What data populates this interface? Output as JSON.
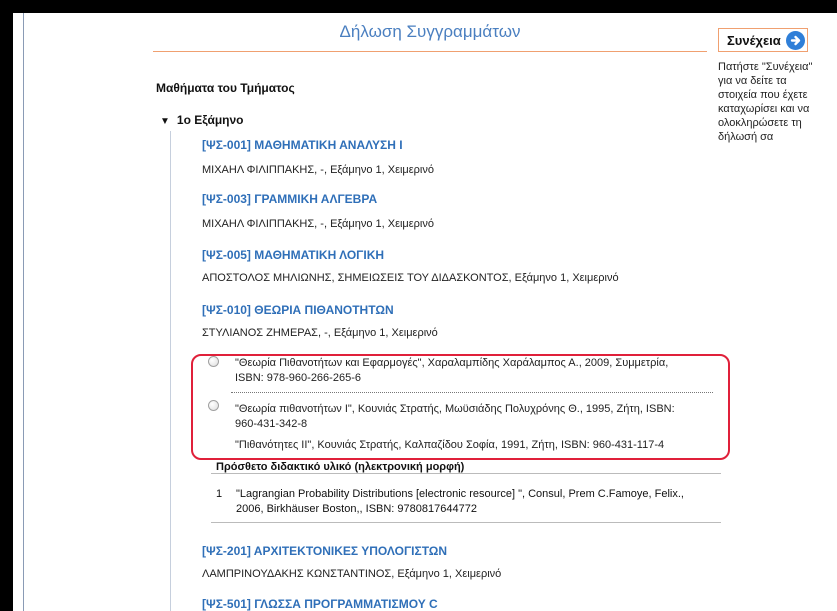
{
  "header": {
    "title": "Δήλωση Συγγραμμάτων"
  },
  "sidebar": {
    "next_label": "Συνέχεια",
    "help_lines": [
      "Πατήστε \"Συνέχεια\"",
      "για να δείτε τα",
      "στοιχεία που έχετε",
      "καταχωρίσει και να",
      "ολοκληρώσετε τη",
      "δήλωσή σα"
    ]
  },
  "main": {
    "section_title": "Μαθήματα του Τμήματος",
    "semester_label": "1ο Εξάμηνο",
    "courses": [
      {
        "code": "[ΨΣ-001] ΜΑΘΗΜΑΤΙΚΗ ΑΝΑΛΥΣΗ Ι",
        "meta": "ΜΙΧΑΗΛ ΦΙΛΙΠΠΑΚΗΣ, -, Εξάμηνο 1, Χειμερινό"
      },
      {
        "code": "[ΨΣ-003] ΓΡΑΜΜΙΚΗ ΑΛΓΕΒΡΑ",
        "meta": "ΜΙΧΑΗΛ ΦΙΛΙΠΠΑΚΗΣ, -, Εξάμηνο 1, Χειμερινό"
      },
      {
        "code": "[ΨΣ-005] ΜΑΘΗΜΑΤΙΚΗ ΛΟΓΙΚΗ",
        "meta": "ΑΠΟΣΤΟΛΟΣ ΜΗΛΙΩΝΗΣ, ΣΗΜΕΙΩΣΕΙΣ ΤΟΥ ΔΙΔΑΣΚΟΝΤΟΣ, Εξάμηνο 1, Χειμερινό"
      },
      {
        "code": "[ΨΣ-010] ΘΕΩΡΙΑ ΠΙΘΑΝΟΤΗΤΩΝ",
        "meta": "ΣΤΥΛΙΑΝΟΣ ΖΗΜΕΡΑΣ, -, Εξάμηνο 1, Χειμερινό"
      },
      {
        "code": "[ΨΣ-201] ΑΡΧΙΤΕΚΤΟΝΙΚΕΣ ΥΠΟΛΟΓΙΣΤΩΝ",
        "meta": "ΛΑΜΠΡΙΝΟΥΔΑΚΗΣ ΚΩΝΣΤΑΝΤΙΝΟΣ, Εξάμηνο 1, Χειμερινό"
      },
      {
        "code": "[ΨΣ-501] ΓΛΩΣΣΑ ΠΡΟΓΡΑΜΜΑΤΙΣΜΟΥ C",
        "meta": ""
      }
    ],
    "book_options": [
      {
        "line1": "\"Θεωρία Πιθανοτήτων και Εφαρμογές\", Χαραλαμπίδης Χαράλαμπος Α., 2009, Συμμετρία,",
        "line2": "ISBN: 978-960-266-265-6"
      },
      {
        "line1": "\"Θεωρία πιθανοτήτων Ι\", Κουνιάς Στρατής, Μωϋσιάδης Πολυχρόνης Θ., 1995, Ζήτη, ISBN:",
        "line2": "960-431-342-8",
        "line3": "\"Πιθανότητες ΙΙ\", Κουνιάς Στρατής, Καλπαζίδου Σοφία, 1991, Ζήτη, ISBN: 960-431-117-4"
      }
    ],
    "extra_material": {
      "title": "Πρόσθετο διδακτικό υλικό (ηλεκτρονική μορφή)",
      "items": [
        {
          "num": "1",
          "line1": "\"Lagrangian Probability Distributions [electronic resource] \", Consul, Prem C.Famoye, Felix.,",
          "line2": "2006, Birkhäuser Boston,, ISBN: 9780817644772"
        }
      ]
    }
  },
  "colors": {
    "link": "#2f6fb8",
    "title": "#4a7fc0",
    "highlight": "#e0203a",
    "accent_border": "#f0a070",
    "next_icon": "#2f7fd8"
  }
}
